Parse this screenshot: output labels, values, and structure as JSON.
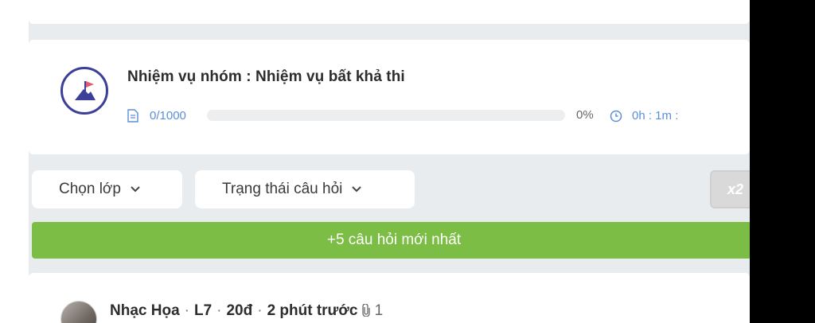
{
  "mission": {
    "title": "Nhiệm vụ nhóm : Nhiệm vụ bất khả thi",
    "count": "0/1000",
    "percent": "0%",
    "progress_fraction": 0,
    "timer": "0h : 1m :"
  },
  "filters": {
    "class_label": "Chọn lớp",
    "status_label": "Trạng thái câu hỏi",
    "x2_label": "x2"
  },
  "banner": {
    "label": "+5 câu hỏi mới nhất"
  },
  "post": {
    "user": "Nhạc Họa",
    "level": "L7",
    "points": "20đ",
    "time": "2 phút trước",
    "attachments": "1"
  },
  "colors": {
    "accent": "#5a8fd8",
    "banner": "#7cbd46",
    "icon": "#3b3f9a"
  }
}
